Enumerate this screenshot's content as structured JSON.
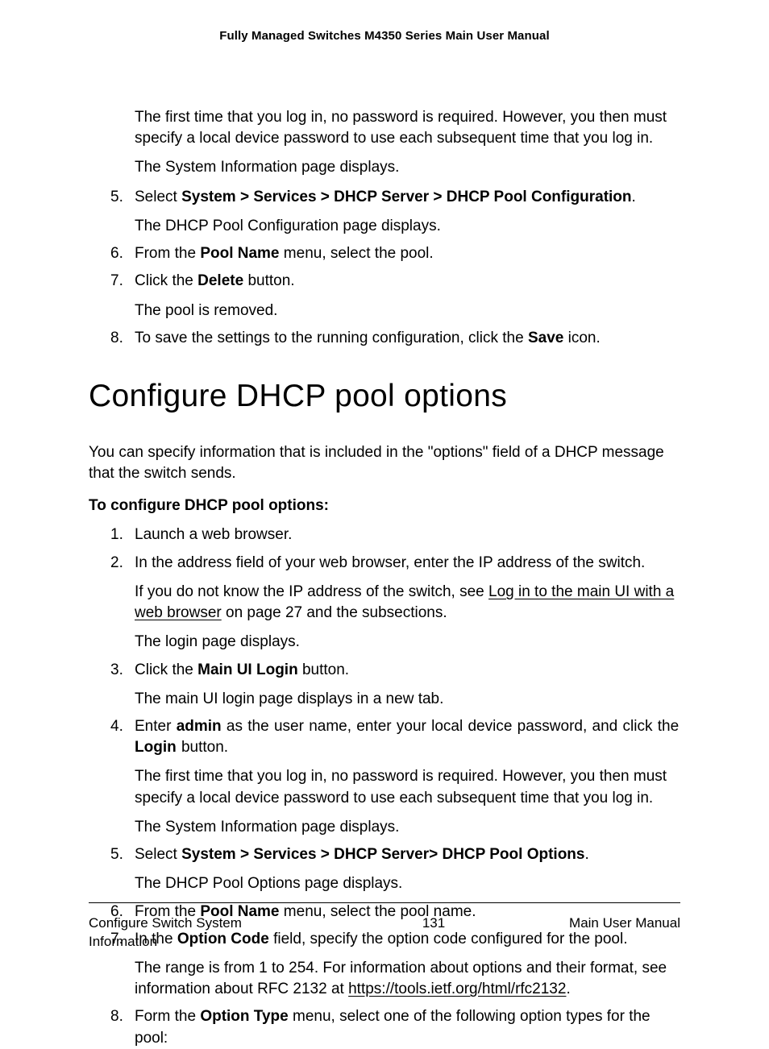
{
  "header": {
    "running_title": "Fully Managed Switches M4350 Series Main User Manual"
  },
  "intro_continued": {
    "p1": "The first time that you log in, no password is required. However, you then must specify a local device password to use each subsequent time that you log in.",
    "p2": "The System Information page displays."
  },
  "steps_a": {
    "s5": {
      "num": "5.",
      "line1_pre": "Select ",
      "line1_bold": "System > Services > DHCP Server > DHCP Pool Configuration",
      "line1_post": ".",
      "line2": "The DHCP Pool Configuration page displays."
    },
    "s6": {
      "num": "6.",
      "line1_pre": "From the ",
      "line1_bold": "Pool Name",
      "line1_post": " menu, select the pool."
    },
    "s7": {
      "num": "7.",
      "line1_pre": "Click the ",
      "line1_bold": "Delete",
      "line1_post": " button.",
      "line2": "The pool is removed."
    },
    "s8": {
      "num": "8.",
      "line1_pre": "To save the settings to the running configuration, click the ",
      "line1_bold": "Save",
      "line1_post": " icon."
    }
  },
  "section": {
    "title": "Configure DHCP pool options",
    "lead": "You can specify information that is included in the \"options\" field of a DHCP message that the switch sends.",
    "task_heading": "To configure DHCP pool options:"
  },
  "steps_b": {
    "s1": {
      "num": "1.",
      "line1": "Launch a web browser."
    },
    "s2": {
      "num": "2.",
      "line1": "In the address field of your web browser, enter the IP address of the switch.",
      "p2_pre": "If you do not know the IP address of the switch, see ",
      "p2_link": "Log in to the main UI with a web browser",
      "p2_post": " on page 27 and the subsections.",
      "p3": "The login page displays."
    },
    "s3": {
      "num": "3.",
      "line1_pre": "Click the ",
      "line1_bold": "Main UI Login",
      "line1_post": " button.",
      "line2": "The main UI login page displays in a new tab."
    },
    "s4": {
      "num": "4.",
      "a_pre": "Enter ",
      "a_bold1": "admin",
      "a_mid": " as the user name, enter your local device password, and click the ",
      "a_bold2": "Login",
      "a_post": " button.",
      "p2": "The first time that you log in, no password is required. However, you then must specify a local device password to use each subsequent time that you log in.",
      "p3": "The System Information page displays."
    },
    "s5": {
      "num": "5.",
      "line1_pre": "Select ",
      "line1_bold": "System > Services > DHCP Server> DHCP Pool Options",
      "line1_post": ".",
      "line2": "The DHCP Pool Options page displays."
    },
    "s6": {
      "num": "6.",
      "line1_pre": "From the ",
      "line1_bold": "Pool Name",
      "line1_post": " menu, select the pool name."
    },
    "s7": {
      "num": "7.",
      "line1_pre": "In the ",
      "line1_bold": "Option Code",
      "line1_post": " field, specify the option code configured for the pool.",
      "p2_pre": "The range is from 1 to 254. For information about options and their format, see information about RFC 2132 at ",
      "p2_link": "https://tools.ietf.org/html/rfc2132",
      "p2_post": "."
    },
    "s8": {
      "num": "8.",
      "line1_pre": "Form the ",
      "line1_bold": "Option Type",
      "line1_post": " menu, select one of the following option types for the pool:"
    }
  },
  "footer": {
    "left": "Configure Switch System Information",
    "center": "131",
    "right": "Main User Manual"
  }
}
